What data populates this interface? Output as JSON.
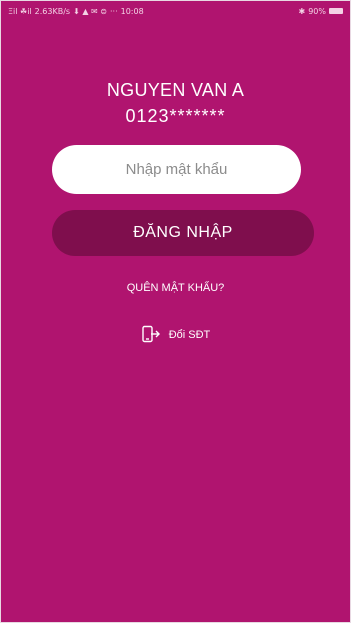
{
  "status_bar": {
    "signal": "Ξil ☘il",
    "speed": "2.63KB/s",
    "icons": "⬇ ▲ ✉ ⊜",
    "dots": "···",
    "time": "10:08",
    "battery_symbol": "✱",
    "battery": "90%"
  },
  "account": {
    "name": "NGUYEN VAN A",
    "phone": "0123*******"
  },
  "password": {
    "value": "",
    "placeholder": "Nhập mật khẩu"
  },
  "login": {
    "label": "ĐĂNG NHẬP"
  },
  "forgot": {
    "label": "QUÊN MẬT KHẨU?"
  },
  "change_phone": {
    "label": "Đổi SĐT",
    "icon": "phone-switch-icon"
  },
  "colors": {
    "background": "#b0146f",
    "button": "#7f0e4d",
    "input_bg": "#ffffff",
    "text": "#ffffff"
  }
}
